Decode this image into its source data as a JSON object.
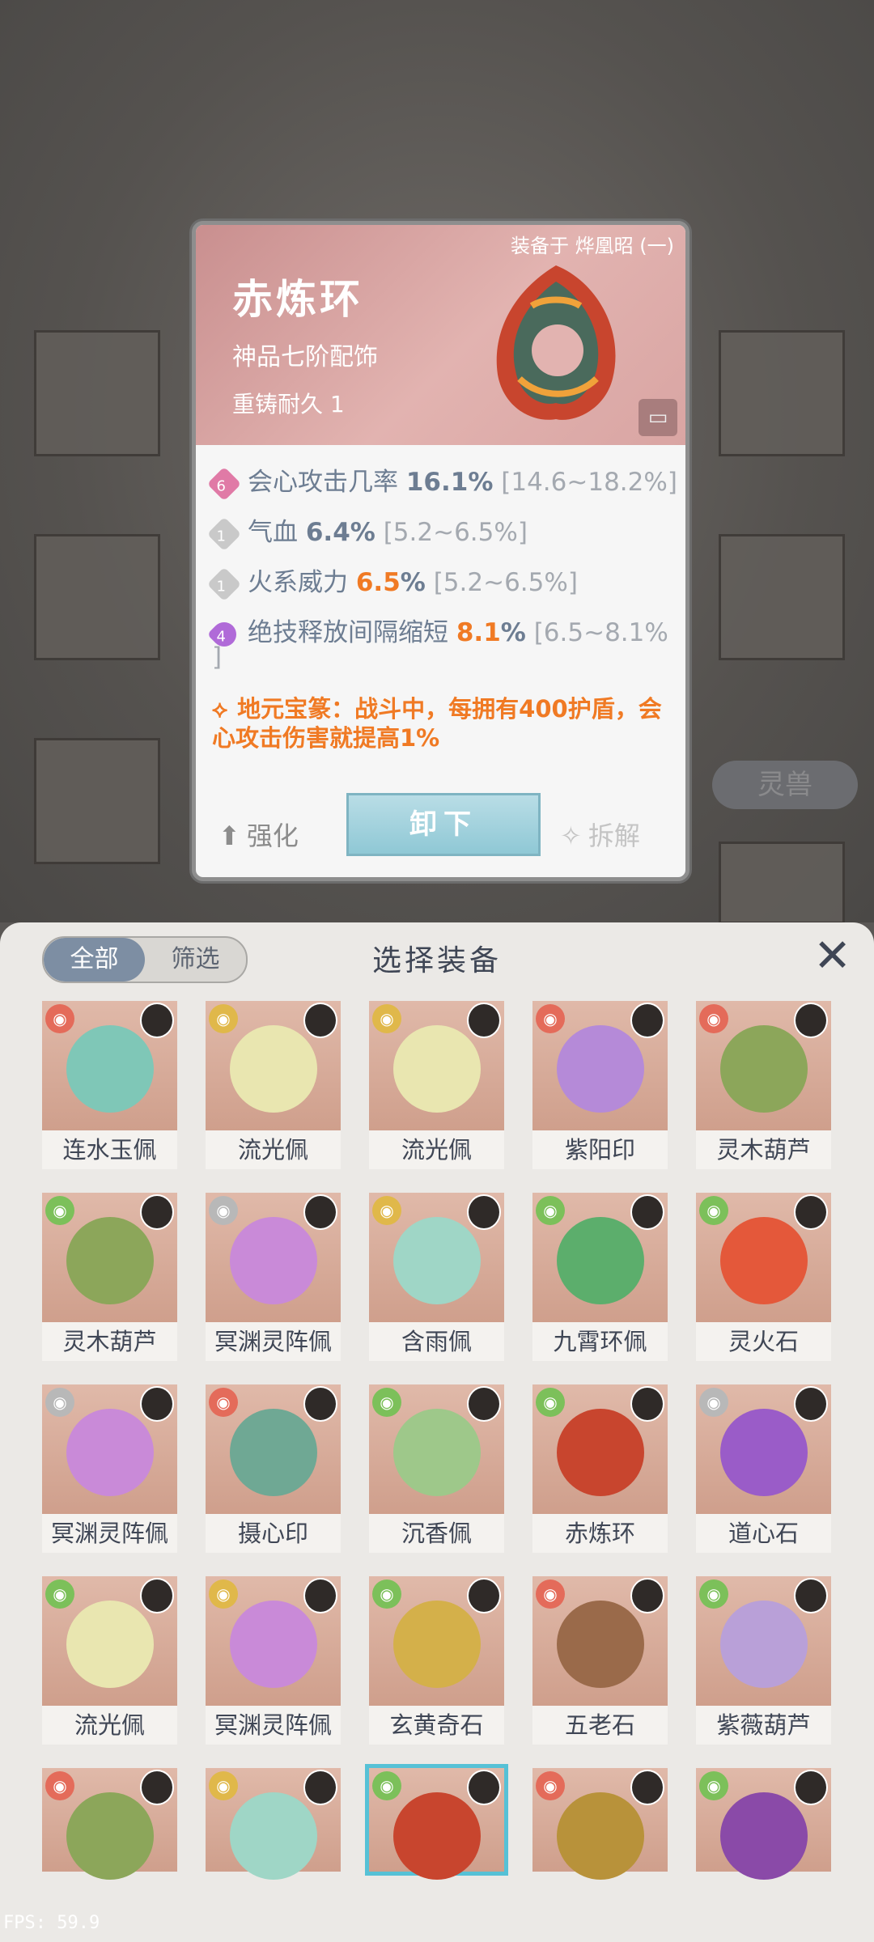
{
  "popup": {
    "equipped_on": "装备于 烨凰昭 (一)",
    "name": "赤炼环",
    "grade": "神品七阶配饰",
    "reforge": "重铸耐久 1",
    "stats": [
      {
        "badge": "6",
        "label": "会心攻击几率",
        "value": "16.1%",
        "range": "[14.6~18.2%]"
      },
      {
        "badge": "1",
        "label": "气血",
        "value": "6.4%",
        "range": "[5.2~6.5%]"
      },
      {
        "badge": "1",
        "label": "火系威力",
        "value": "6.5",
        "value_suffix": "%",
        "range": "[5.2~6.5%]"
      },
      {
        "badge": "4",
        "label": "绝技释放间隔缩短",
        "value": "8.1",
        "value_suffix": "%",
        "range": "[6.5~8.1%",
        "range_end": "]"
      }
    ],
    "special": "地元宝篆：战斗中，每拥有400护盾，会心攻击伤害就提高1%",
    "unequip_label": "卸下",
    "enhance_label": "强化",
    "dismantle_label": "拆解"
  },
  "background": {
    "spirit_beast_label": "灵兽"
  },
  "panel": {
    "tabs": [
      "全部",
      "筛选"
    ],
    "title": "选择装备",
    "close_icon": "close-icon"
  },
  "items": [
    {
      "name": "连水玉佩",
      "elem": "fire"
    },
    {
      "name": "流光佩",
      "elem": "gold"
    },
    {
      "name": "流光佩",
      "elem": "gold"
    },
    {
      "name": "紫阳印",
      "elem": "fire"
    },
    {
      "name": "灵木葫芦",
      "elem": "fire"
    },
    {
      "name": "灵木葫芦",
      "elem": "wood"
    },
    {
      "name": "冥渊灵阵佩",
      "elem": "grey"
    },
    {
      "name": "含雨佩",
      "elem": "gold"
    },
    {
      "name": "九霄环佩",
      "elem": "wood"
    },
    {
      "name": "灵火石",
      "elem": "wood"
    },
    {
      "name": "冥渊灵阵佩",
      "elem": "grey"
    },
    {
      "name": "摄心印",
      "elem": "fire"
    },
    {
      "name": "沉香佩",
      "elem": "wood"
    },
    {
      "name": "赤炼环",
      "elem": "wood"
    },
    {
      "name": "道心石",
      "elem": "grey"
    },
    {
      "name": "流光佩",
      "elem": "wood"
    },
    {
      "name": "冥渊灵阵佩",
      "elem": "gold"
    },
    {
      "name": "玄黄奇石",
      "elem": "wood"
    },
    {
      "name": "五老石",
      "elem": "fire"
    },
    {
      "name": "紫薇葫芦",
      "elem": "wood"
    },
    {
      "name": "",
      "elem": "fire"
    },
    {
      "name": "",
      "elem": "gold"
    },
    {
      "name": "",
      "elem": "wood"
    },
    {
      "name": "",
      "elem": "fire"
    },
    {
      "name": "",
      "elem": "wood"
    }
  ],
  "fps": "FPS: 59.9"
}
